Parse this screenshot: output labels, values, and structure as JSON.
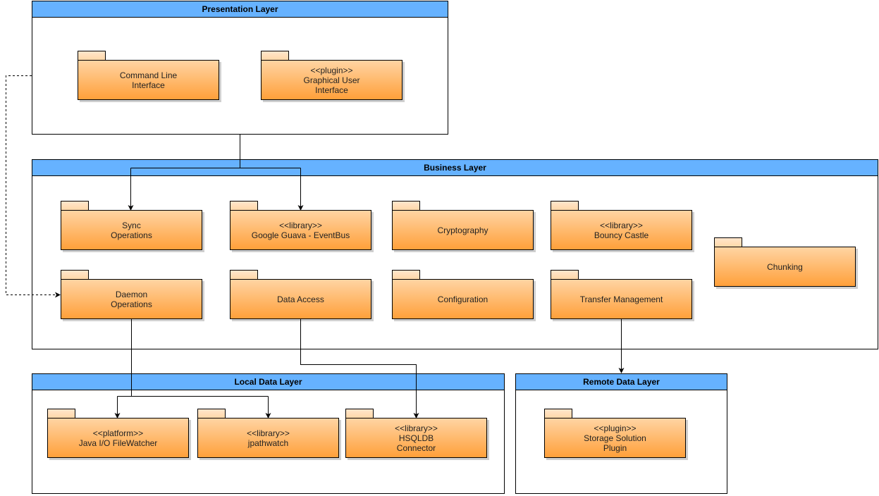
{
  "layers": {
    "presentation": {
      "title": "Presentation Layer"
    },
    "business": {
      "title": "Business Layer"
    },
    "local": {
      "title": "Local Data Layer"
    },
    "remote": {
      "title": "Remote Data Layer"
    }
  },
  "packages": [
    {
      "id": "command-line-interface",
      "layer": "presentation",
      "label": "Command Line\nInterface"
    },
    {
      "id": "graphical-user-interface",
      "layer": "presentation",
      "label": "<<plugin>>\nGraphical User\nInterface"
    },
    {
      "id": "sync-operations",
      "layer": "business",
      "label": "Sync\nOperations"
    },
    {
      "id": "google-guava-eventbus",
      "layer": "business",
      "label": "<<library>>\nGoogle Guava - EventBus"
    },
    {
      "id": "cryptography",
      "layer": "business",
      "label": "Cryptography"
    },
    {
      "id": "bouncy-castle",
      "layer": "business",
      "label": "<<library>>\nBouncy Castle"
    },
    {
      "id": "chunking",
      "layer": "business",
      "label": "Chunking"
    },
    {
      "id": "daemon-operations",
      "layer": "business",
      "label": "Daemon\nOperations"
    },
    {
      "id": "data-access",
      "layer": "business",
      "label": "Data Access"
    },
    {
      "id": "configuration",
      "layer": "business",
      "label": "Configuration"
    },
    {
      "id": "transfer-management",
      "layer": "business",
      "label": "Transfer Management"
    },
    {
      "id": "java-io-filewatcher",
      "layer": "local",
      "label": "<<platform>>\nJava I/O FileWatcher"
    },
    {
      "id": "jpathwatch",
      "layer": "local",
      "label": "<<library>>\njpathwatch"
    },
    {
      "id": "hsqldb-connector",
      "layer": "local",
      "label": "<<library>>\nHSQLDB\nConnector"
    },
    {
      "id": "storage-solution-plugin",
      "layer": "remote",
      "label": "<<plugin>>\nStorage Solution\nPlugin"
    }
  ],
  "colors": {
    "layer_header": "#66b2ff",
    "package_top": "#ffd4a3",
    "package_bottom": "#ffa03a"
  }
}
